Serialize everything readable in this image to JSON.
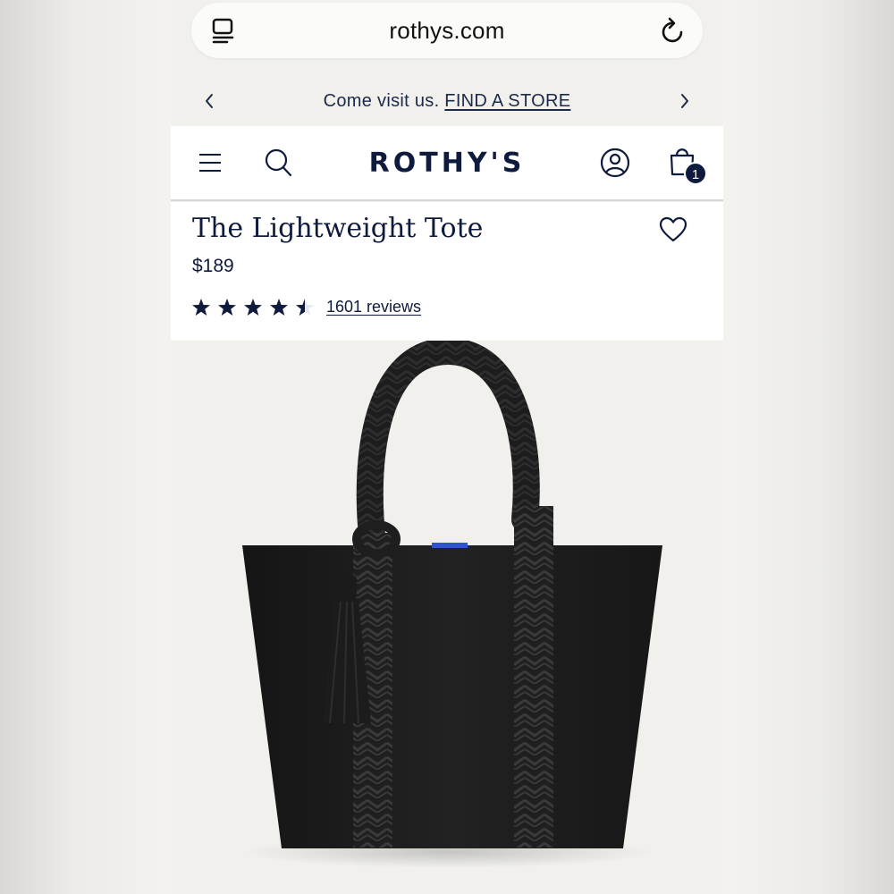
{
  "browser": {
    "url": "rothys.com",
    "tabs_icon": "tabs-icon",
    "reload_icon": "reload-icon"
  },
  "promo": {
    "text": "Come visit us.",
    "link": "FIND A STORE",
    "prev_icon": "chevron-left-icon",
    "next_icon": "chevron-right-icon"
  },
  "header": {
    "logo": "ROTHY'S",
    "menu_icon": "hamburger-menu-icon",
    "search_icon": "search-icon",
    "account_icon": "account-icon",
    "bag_icon": "shopping-bag-icon",
    "bag_count": "1"
  },
  "product": {
    "title": "The Lightweight Tote",
    "price": "$189",
    "rating": 4.5,
    "rating_max": 5,
    "reviews": "1601 reviews",
    "favorite_icon": "heart-icon",
    "image_icon": "tote-bag-image"
  },
  "colors": {
    "navy": "#0f1b3d",
    "background": "#f1f0ec",
    "bag": "#1c1c1c"
  }
}
